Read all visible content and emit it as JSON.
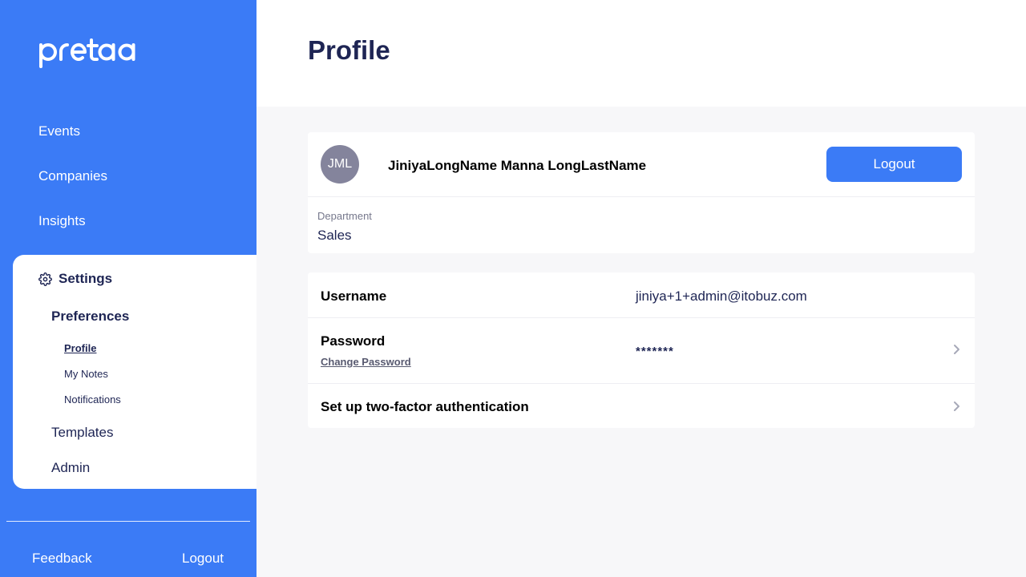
{
  "brand": {
    "logo_text": "pretaa"
  },
  "sidebar": {
    "nav": [
      {
        "label": "Events"
      },
      {
        "label": "Companies"
      },
      {
        "label": "Insights"
      }
    ],
    "settings": {
      "label": "Settings",
      "icon": "gear-icon",
      "preferences": {
        "label": "Preferences",
        "items": [
          {
            "label": "Profile",
            "active": true
          },
          {
            "label": "My Notes"
          },
          {
            "label": "Notifications"
          }
        ]
      },
      "templates_label": "Templates",
      "admin_label": "Admin"
    },
    "footer": {
      "feedback_label": "Feedback",
      "logout_label": "Logout"
    }
  },
  "header": {
    "title": "Profile"
  },
  "profile": {
    "initials": "JML",
    "full_name": "JiniyaLongName Manna LongLastName",
    "logout_label": "Logout",
    "department_label": "Department",
    "department_value": "Sales"
  },
  "account": {
    "username_label": "Username",
    "username_value": "jiniya+1+admin@itobuz.com",
    "password_label": "Password",
    "change_password_label": "Change Password",
    "password_value": "*******",
    "two_factor_label": "Set up two-factor authentication"
  },
  "colors": {
    "sidebar": "#3b7bf6",
    "primary_text": "#1e2554",
    "button": "#3b7bf6",
    "avatar": "#84849c",
    "page_background": "#f7f7f9"
  }
}
